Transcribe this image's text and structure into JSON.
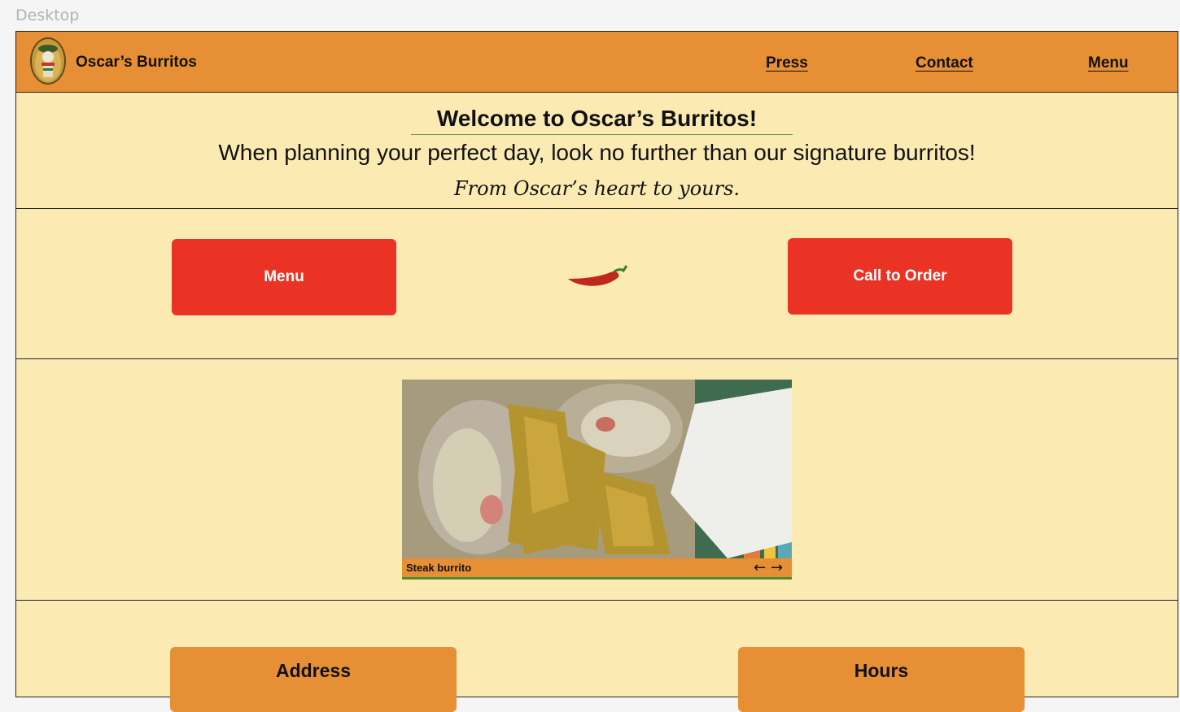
{
  "canvas": {
    "frame_label": "Desktop"
  },
  "nav": {
    "brand": "Oscar’s Burritos",
    "links": [
      "Press",
      "Contact",
      "Menu"
    ]
  },
  "welcome": {
    "title": "Welcome to Oscar’s Burritos!",
    "subtitle": "When planning your perfect day, look no further than our signature burritos!",
    "tagline": "From Oscar’s heart to yours."
  },
  "actions": {
    "menu_label": "Menu",
    "order_label": "Call to Order"
  },
  "gallery": {
    "caption": "Steak burrito",
    "prev_icon": "arrow-left-icon",
    "next_icon": "arrow-right-icon"
  },
  "info": {
    "address_label": "Address",
    "hours_label": "Hours"
  },
  "colors": {
    "header": "#e68f35",
    "background": "#fbebb3",
    "button": "#ea3324",
    "accent_green": "#4f8a2b"
  }
}
